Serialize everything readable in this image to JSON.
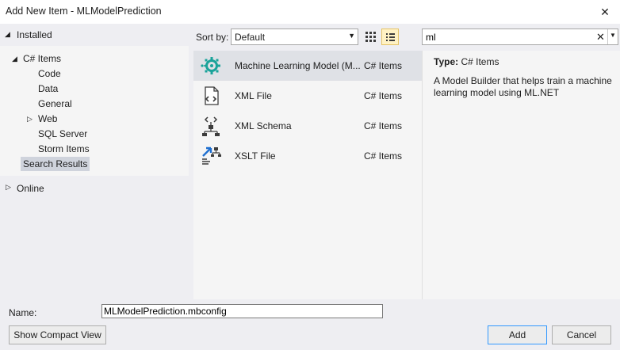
{
  "window": {
    "title": "Add New Item - MLModelPrediction",
    "close_glyph": "✕"
  },
  "tree": {
    "installed_label": "Installed",
    "csharp_items_label": "C# Items",
    "children": [
      "Code",
      "Data",
      "General",
      "Web",
      "SQL Server",
      "Storm Items"
    ],
    "search_results_label": "Search Results",
    "online_label": "Online"
  },
  "toolbar": {
    "sort_by_label": "Sort by:",
    "sort_value": "Default",
    "search_value": "ml",
    "clear_glyph": "✕"
  },
  "templates": [
    {
      "name": "Machine Learning Model (M...",
      "lang": "C# Items",
      "icon": "ml-model-icon",
      "selected": true
    },
    {
      "name": "XML File",
      "lang": "C# Items",
      "icon": "xml-file-icon",
      "selected": false
    },
    {
      "name": "XML Schema",
      "lang": "C# Items",
      "icon": "xml-schema-icon",
      "selected": false
    },
    {
      "name": "XSLT File",
      "lang": "C# Items",
      "icon": "xslt-file-icon",
      "selected": false
    }
  ],
  "details": {
    "type_label": "Type:",
    "type_value": "C# Items",
    "description": "A Model Builder that helps train a machine learning model using ML.NET"
  },
  "bottom": {
    "name_label": "Name:",
    "name_value": "MLModelPrediction.mbconfig",
    "compact_view_label": "Show Compact View",
    "add_label": "Add",
    "cancel_label": "Cancel"
  },
  "colors": {
    "accent": "#3399ff",
    "ml_icon": "#1aa39a",
    "selection": "#dfe1e6",
    "list_view_active": "#fff2c4"
  }
}
